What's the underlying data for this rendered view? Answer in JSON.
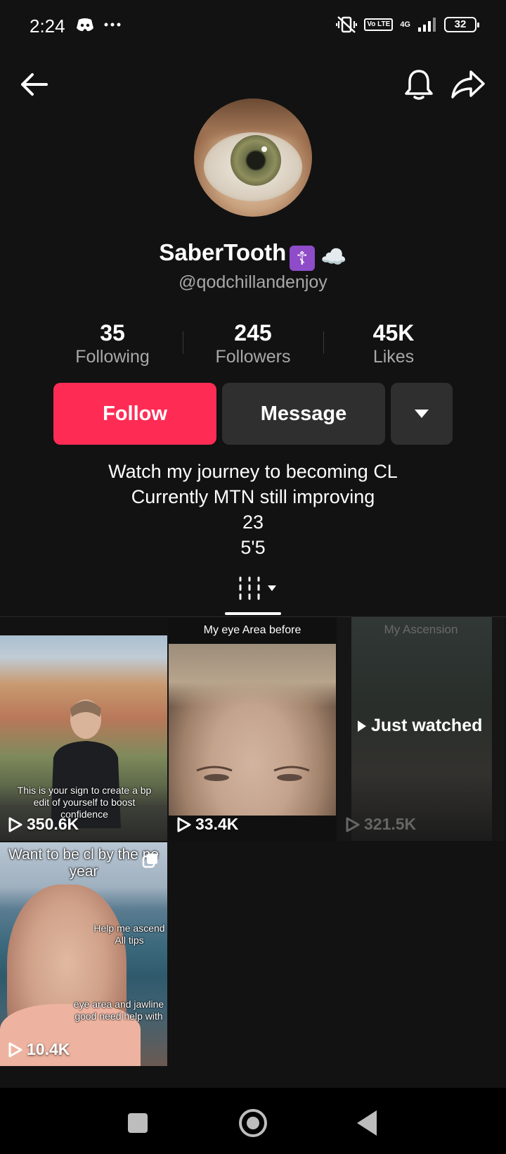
{
  "status_bar": {
    "time": "2:24",
    "volte": "Vo LTE",
    "network": "4G",
    "battery": "32"
  },
  "profile": {
    "name": "SaberTooth",
    "name_badge": "☦",
    "name_emoji": "☁️",
    "handle": "@qodchillandenjoy"
  },
  "stats": [
    {
      "value": "35",
      "label": "Following"
    },
    {
      "value": "245",
      "label": "Followers"
    },
    {
      "value": "45K",
      "label": "Likes"
    }
  ],
  "buttons": {
    "follow": "Follow",
    "message": "Message"
  },
  "bio": [
    "Watch my journey to becoming CL",
    "Currently MTN still improving",
    "23",
    "5'5"
  ],
  "videos": [
    {
      "views": "350.6K",
      "caption": "This is your sign to create a bp edit of yourself to boost confidence"
    },
    {
      "views": "33.4K",
      "title": "My eye Area before"
    },
    {
      "views": "321.5K",
      "title": "My Ascension",
      "overlay": "Just watched"
    },
    {
      "views": "10.4K",
      "title": "Want to be cl by the ne year",
      "caption_mid": "Help me ascend All tips",
      "caption_low": "eye area and jawline good need help with"
    }
  ],
  "colors": {
    "background": "#121212",
    "follow_button": "#fe2c55",
    "secondary_button": "#2f2f2f",
    "muted_text": "#a8a8a8"
  }
}
